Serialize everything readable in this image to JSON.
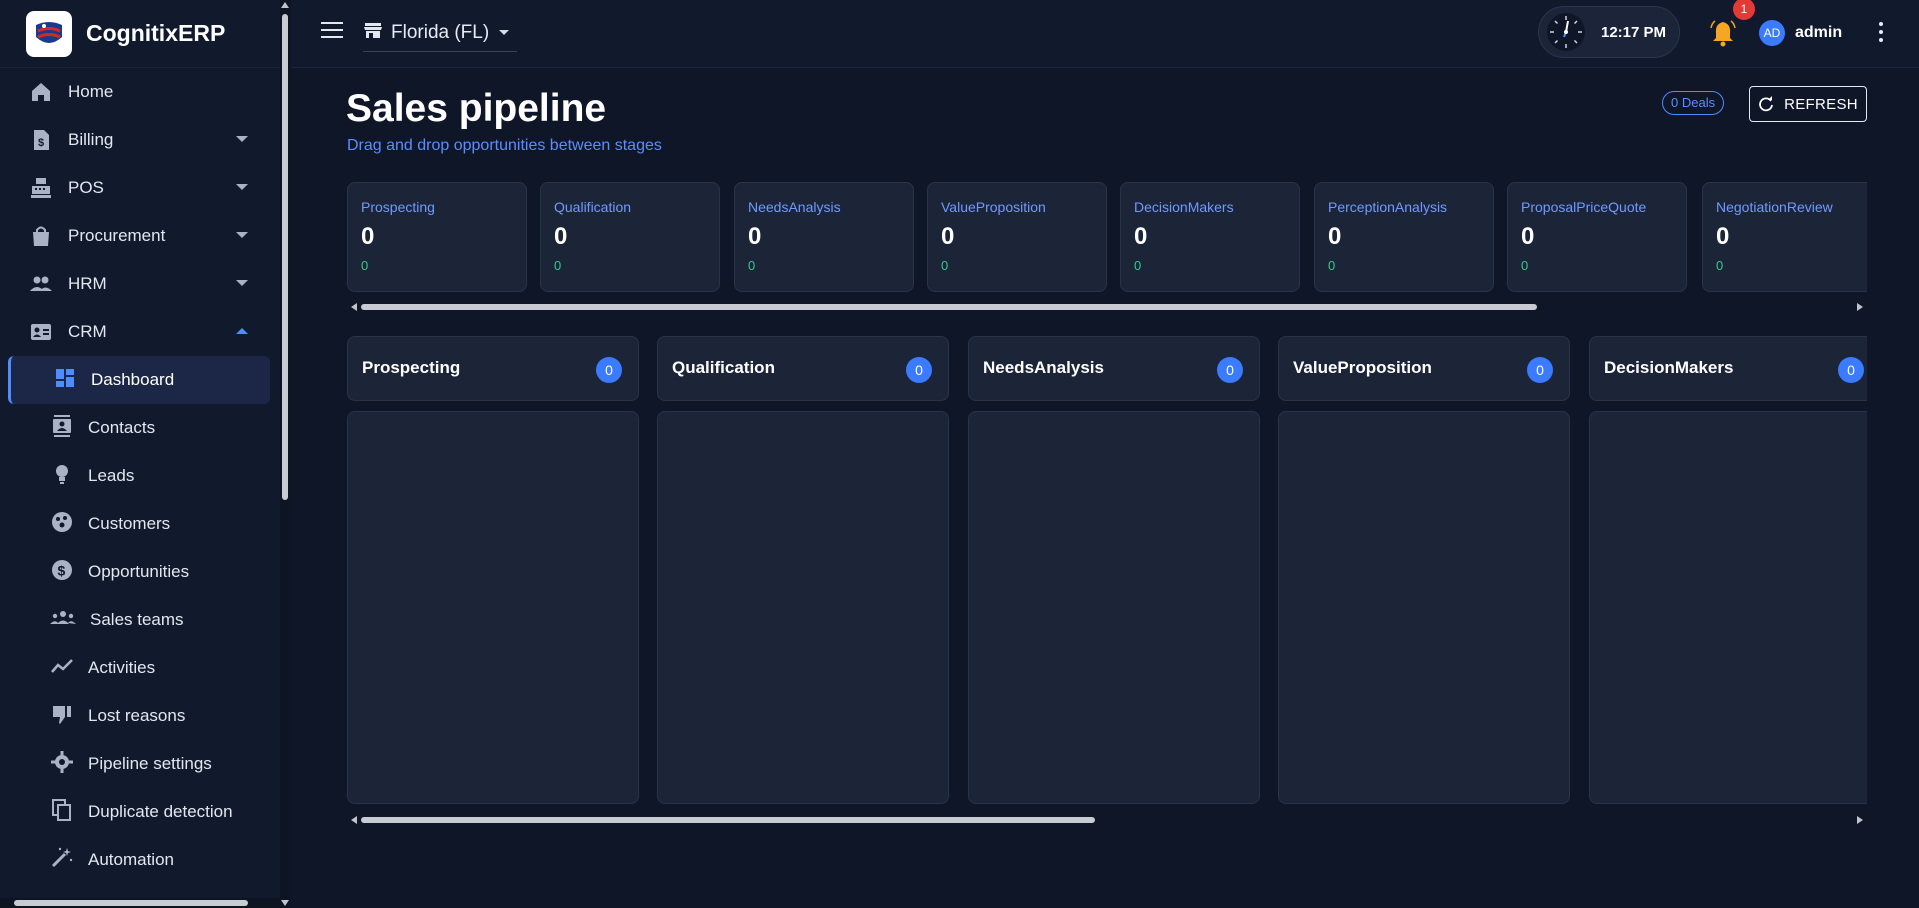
{
  "app": {
    "name": "CognitixERP"
  },
  "sidebar": {
    "items": [
      {
        "label": "Home",
        "icon": "home-icon"
      },
      {
        "label": "Billing",
        "icon": "billing-icon"
      },
      {
        "label": "POS",
        "icon": "pos-icon"
      },
      {
        "label": "Procurement",
        "icon": "bag-icon"
      },
      {
        "label": "HRM",
        "icon": "people-icon"
      },
      {
        "label": "CRM",
        "icon": "contact-card-icon"
      }
    ],
    "crm_sub": [
      {
        "label": "Dashboard",
        "icon": "dashboard-icon"
      },
      {
        "label": "Contacts",
        "icon": "contacts-icon"
      },
      {
        "label": "Leads",
        "icon": "lightbulb-icon"
      },
      {
        "label": "Customers",
        "icon": "customers-icon"
      },
      {
        "label": "Opportunities",
        "icon": "dollar-icon"
      },
      {
        "label": "Sales teams",
        "icon": "team-icon"
      },
      {
        "label": "Activities",
        "icon": "trend-icon"
      },
      {
        "label": "Lost reasons",
        "icon": "thumb-down-icon"
      },
      {
        "label": "Pipeline settings",
        "icon": "gear-icon"
      },
      {
        "label": "Duplicate detection",
        "icon": "copy-icon"
      },
      {
        "label": "Automation",
        "icon": "magic-wand-icon"
      }
    ]
  },
  "topbar": {
    "location": "Florida (FL)",
    "time": "12:17 PM",
    "notifications": "1",
    "user_initials": "AD",
    "user_name": "admin"
  },
  "page": {
    "title": "Sales pipeline",
    "subtitle": "Drag and drop opportunities between stages",
    "deals": "0 Deals",
    "refresh": "REFRESH"
  },
  "stats": [
    {
      "name": "Prospecting",
      "count": "0",
      "amount": "0"
    },
    {
      "name": "Qualification",
      "count": "0",
      "amount": "0"
    },
    {
      "name": "NeedsAnalysis",
      "count": "0",
      "amount": "0"
    },
    {
      "name": "ValueProposition",
      "count": "0",
      "amount": "0"
    },
    {
      "name": "DecisionMakers",
      "count": "0",
      "amount": "0"
    },
    {
      "name": "PerceptionAnalysis",
      "count": "0",
      "amount": "0"
    },
    {
      "name": "ProposalPriceQuote",
      "count": "0",
      "amount": "0"
    },
    {
      "name": "NegotiationReview",
      "count": "0",
      "amount": "0"
    }
  ],
  "columns": [
    {
      "name": "Prospecting",
      "count": "0"
    },
    {
      "name": "Qualification",
      "count": "0"
    },
    {
      "name": "NeedsAnalysis",
      "count": "0"
    },
    {
      "name": "ValueProposition",
      "count": "0"
    },
    {
      "name": "DecisionMakers",
      "count": "0"
    }
  ],
  "colors": {
    "accent": "#3b7bff",
    "stat_name": "#6f9bff",
    "stat_amount": "#36c98d",
    "bell": "#f5a623",
    "badge": "#e53935"
  }
}
